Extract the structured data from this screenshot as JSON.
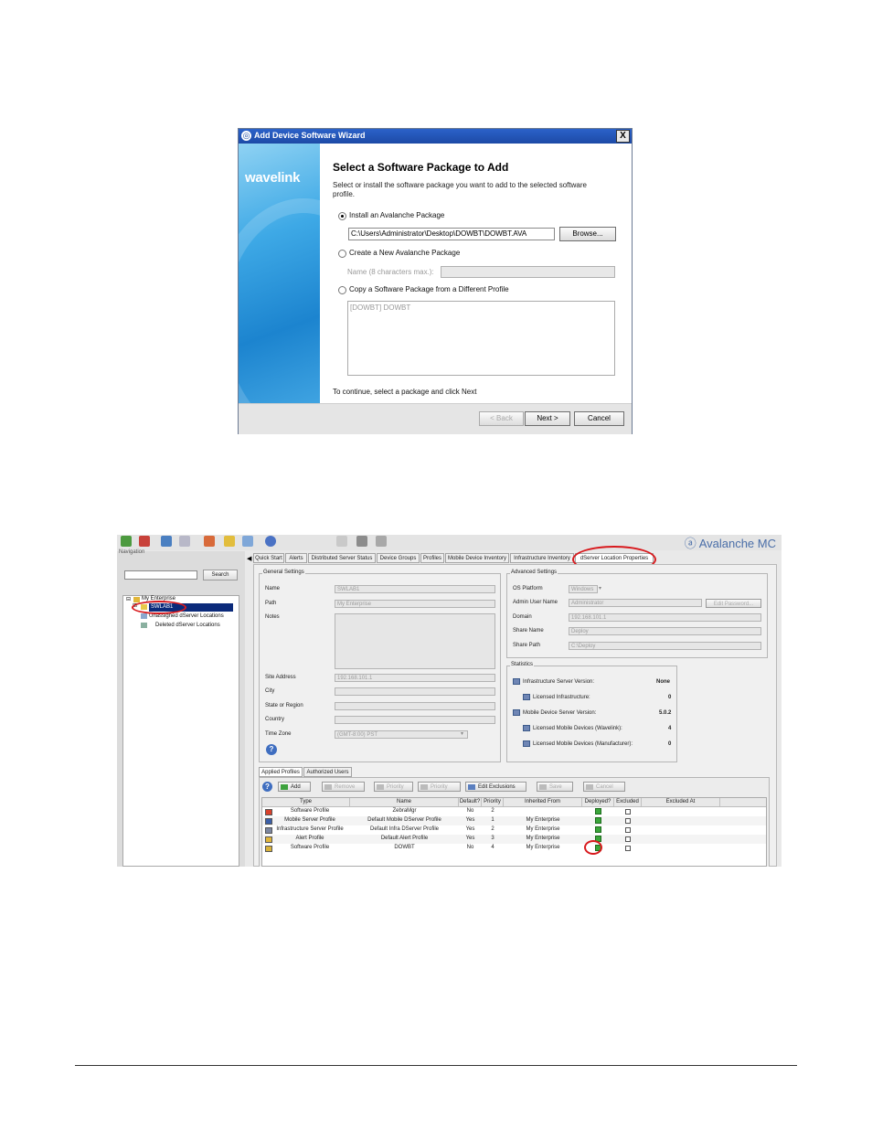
{
  "wizard": {
    "title": "Add Device Software Wizard",
    "close": "X",
    "logo": "wavelink",
    "heading": "Select a Software Package to Add",
    "description": "Select or install the software package you want to add to the selected software profile.",
    "option_install": "Install an Avalanche Package",
    "path_value": "C:\\Users\\Administrator\\Desktop\\DOWBT\\DOWBT.AVA",
    "browse": "Browse...",
    "option_create": "Create a New Avalanche Package",
    "name_label": "Name (8 characters max.):",
    "option_copy": "Copy a Software Package from a Different Profile",
    "copy_list_item": "[DOWBT] DOWBT",
    "instruction": "To continue, select a package and click Next",
    "back": "< Back",
    "next": "Next >",
    "cancel": "Cancel"
  },
  "ava": {
    "brand": "Avalanche MC",
    "nav_label": "Navigation",
    "search_button": "Search",
    "tree": {
      "root": "My Enterprise",
      "selected": "SWLAB1",
      "unassigned": "Unassigned dServer Locations",
      "deleted": "Deleted dServer Locations"
    },
    "tabs": [
      "Quick Start",
      "Alerts",
      "Distributed Server Status",
      "Device Groups",
      "Profiles",
      "Mobile Device Inventory",
      "Infrastructure Inventory",
      "dServer Location Properties"
    ],
    "general": {
      "label": "General Settings",
      "name_label": "Name",
      "name_value": "SWLAB1",
      "path_label": "Path",
      "path_value": "My Enterprise",
      "notes_label": "Notes",
      "site_label": "Site Address",
      "site_value": "192.168.101.1",
      "city_label": "City",
      "state_label": "State or Region",
      "country_label": "Country",
      "tz_label": "Time Zone",
      "tz_value": "(GMT-8:00) PST"
    },
    "advanced": {
      "label": "Advanced Settings",
      "os_label": "OS Platform",
      "os_value": "Windows",
      "admin_label": "Admin User Name",
      "admin_value": "Administrator",
      "edit_password": "Edit Password...",
      "domain_label": "Domain",
      "domain_value": "192.168.101.1",
      "share_label": "Share Name",
      "share_value": "Deploy",
      "sharepath_label": "Share Path",
      "sharepath_value": "C:\\Deploy"
    },
    "stats": {
      "label": "Statistics",
      "infra_version_label": "Infrastructure Server Version:",
      "infra_version_value": "None",
      "lic_infra_label": "Licensed Infrastructure:",
      "lic_infra_value": "0",
      "mobile_version_label": "Mobile Device Server Version:",
      "mobile_version_value": "5.0.2",
      "lic_wavelink_label": "Licensed Mobile Devices (Wavelink):",
      "lic_wavelink_value": "4",
      "lic_mfr_label": "Licensed Mobile Devices (Manufacturer):",
      "lic_mfr_value": "0"
    },
    "bottom_tabs": [
      "Applied Profiles",
      "Authorized Users"
    ],
    "actions": {
      "add": "Add",
      "remove": "Remove",
      "priority_up": "Priority",
      "priority_down": "Priority",
      "edit_exclusions": "Edit Exclusions",
      "save": "Save",
      "cancel": "Cancel"
    },
    "table": {
      "headers": [
        "Type",
        "Name",
        "Default?",
        "Priority",
        "Inherited From",
        "Deployed?",
        "Excluded",
        "Excluded At"
      ],
      "rows": [
        {
          "type": "Software Profile",
          "name": "ZebraMgr",
          "default": "No",
          "priority": "2",
          "inherited": "",
          "icon_color": "#d9412b"
        },
        {
          "type": "Mobile Server Profile",
          "name": "Default Mobile DServer Profile",
          "default": "Yes",
          "priority": "1",
          "inherited": "My Enterprise",
          "icon_color": "#3b5fa8"
        },
        {
          "type": "Infrastructure Server Profile",
          "name": "Default Infra DServer Profile",
          "default": "Yes",
          "priority": "2",
          "inherited": "My Enterprise",
          "icon_color": "#7b86a0"
        },
        {
          "type": "Alert Profile",
          "name": "Default Alert Profile",
          "default": "Yes",
          "priority": "3",
          "inherited": "My Enterprise",
          "icon_color": "#e0b53a"
        },
        {
          "type": "Software Profile",
          "name": "DOWBT",
          "default": "No",
          "priority": "4",
          "inherited": "My Enterprise",
          "icon_color": "#d9b23a"
        }
      ]
    }
  }
}
